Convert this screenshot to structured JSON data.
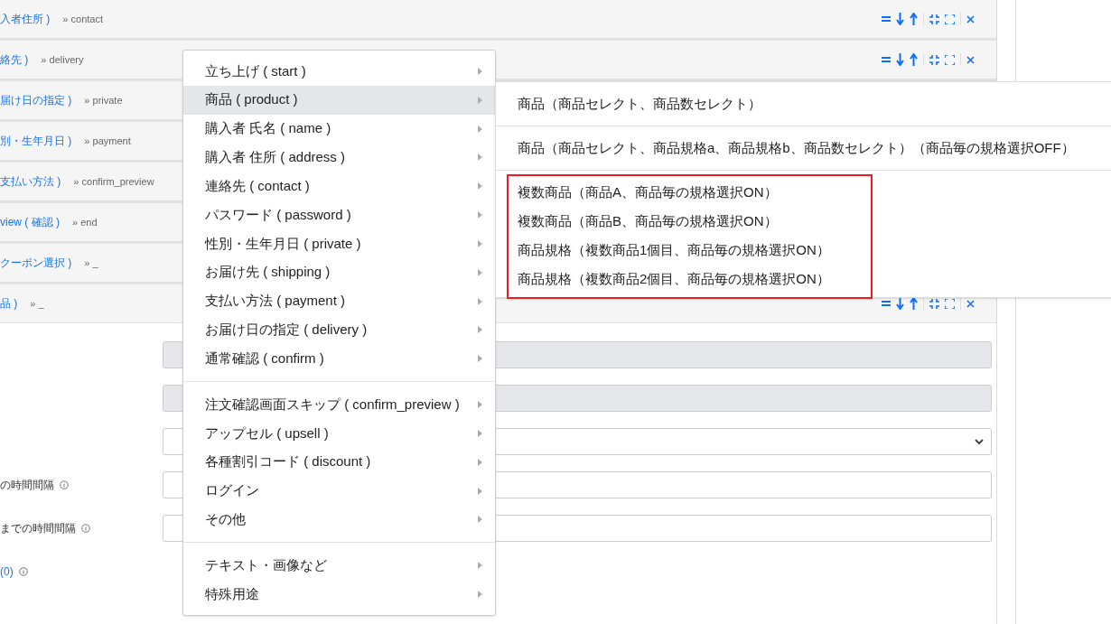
{
  "steps": [
    {
      "label": "入者住所 )",
      "next": "» contact",
      "show_controls": true
    },
    {
      "label": "絡先 )",
      "next": "» delivery",
      "show_controls": true
    },
    {
      "label": "届け日の指定 )",
      "next": "» private",
      "show_controls": false
    },
    {
      "label": "別・生年月日 )",
      "next": "» payment",
      "show_controls": false
    },
    {
      "label": "支払い方法 )",
      "next": "» confirm_preview",
      "show_controls": false
    },
    {
      "label": "view ( 確認 )",
      "next": "» end",
      "show_controls": false
    },
    {
      "label": "クーポン選択 )",
      "next": "» _",
      "show_controls": false
    },
    {
      "label": "品 )",
      "next": "» _",
      "show_controls": true
    }
  ],
  "form": [
    {
      "kind": "disabled"
    },
    {
      "kind": "disabled"
    },
    {
      "kind": "select"
    },
    {
      "kind": "input",
      "label": "の時間間隔"
    },
    {
      "kind": "input",
      "label": "までの時間間隔"
    },
    {
      "kind": "count",
      "label": "(0)"
    }
  ],
  "menu": {
    "groups": [
      [
        {
          "label": "立ち上げ ( start )",
          "selected": false
        },
        {
          "label": "商品 ( product )",
          "selected": true
        },
        {
          "label": "購入者 氏名 ( name )",
          "selected": false
        },
        {
          "label": "購入者 住所 ( address )",
          "selected": false
        },
        {
          "label": "連絡先 ( contact )",
          "selected": false
        },
        {
          "label": "パスワード ( password )",
          "selected": false
        },
        {
          "label": "性別・生年月日 ( private )",
          "selected": false
        },
        {
          "label": "お届け先 ( shipping )",
          "selected": false
        },
        {
          "label": "支払い方法 ( payment )",
          "selected": false
        },
        {
          "label": "お届け日の指定 ( delivery )",
          "selected": false
        },
        {
          "label": "通常確認 ( confirm )",
          "selected": false
        }
      ],
      [
        {
          "label": "注文確認画面スキップ ( confirm_preview )",
          "selected": false
        },
        {
          "label": "アップセル ( upsell )",
          "selected": false
        },
        {
          "label": "各種割引コード ( discount )",
          "selected": false
        },
        {
          "label": "ログイン",
          "selected": false
        },
        {
          "label": "その他",
          "selected": false
        }
      ],
      [
        {
          "label": "テキスト・画像など",
          "selected": false
        },
        {
          "label": "特殊用途",
          "selected": false
        }
      ]
    ]
  },
  "submenu": {
    "groups": [
      {
        "highlighted": false,
        "items": [
          "商品（商品セレクト、商品数セレクト）"
        ]
      },
      {
        "highlighted": false,
        "items": [
          "商品（商品セレクト、商品規格a、商品規格b、商品数セレクト）（商品毎の規格選択OFF）"
        ]
      },
      {
        "highlighted": true,
        "items": [
          "複数商品（商品A、商品毎の規格選択ON）",
          "複数商品（商品B、商品毎の規格選択ON）",
          "商品規格（複数商品1個目、商品毎の規格選択ON）",
          "商品規格（複数商品2個目、商品毎の規格選択ON）"
        ]
      }
    ]
  }
}
